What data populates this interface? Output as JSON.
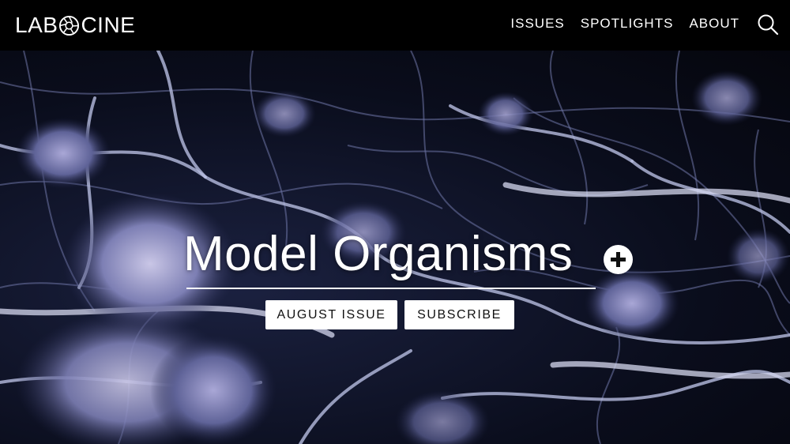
{
  "brand": {
    "name_left": "LAB",
    "name_right": "CINE",
    "icon": "aperture-icon"
  },
  "nav": {
    "items": [
      {
        "label": "ISSUES"
      },
      {
        "label": "SPOTLIGHTS"
      },
      {
        "label": "ABOUT"
      }
    ],
    "search_icon": "search-icon"
  },
  "hero": {
    "title": "Model Organisms",
    "expand_icon": "plus-circle-icon",
    "buttons": {
      "issue_label": "AUGUST ISSUE",
      "subscribe_label": "SUBSCRIBE"
    },
    "background": "neuron-network-image"
  },
  "colors": {
    "header_bg": "#000000",
    "text": "#ffffff",
    "button_bg": "#ffffff",
    "button_text": "#111111",
    "hero_dark": "#0a0d1c",
    "neuron": "#9ea6d0"
  }
}
